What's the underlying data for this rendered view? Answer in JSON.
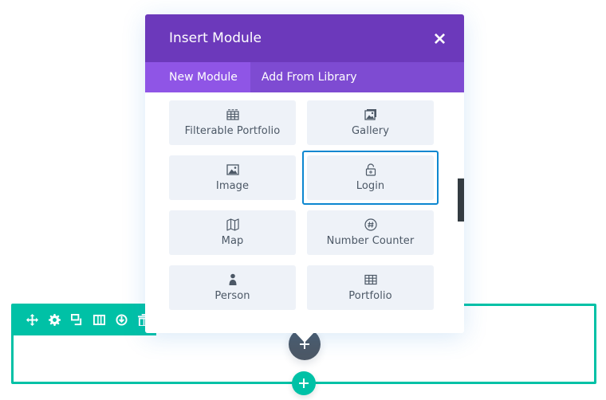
{
  "modal": {
    "title": "Insert Module",
    "close_icon": "close-icon",
    "tabs": [
      {
        "label": "New Module",
        "active": true
      },
      {
        "label": "Add From Library",
        "active": false
      }
    ],
    "modules": [
      {
        "label": "Filterable Portfolio",
        "icon": "grid-icon"
      },
      {
        "label": "Gallery",
        "icon": "gallery-icon"
      },
      {
        "label": "Image",
        "icon": "image-icon"
      },
      {
        "label": "Login",
        "icon": "unlock-icon",
        "selected": true
      },
      {
        "label": "Map",
        "icon": "map-icon"
      },
      {
        "label": "Number Counter",
        "icon": "hash-icon"
      },
      {
        "label": "Person",
        "icon": "person-icon"
      },
      {
        "label": "Portfolio",
        "icon": "grid-icon"
      }
    ]
  },
  "row_toolbar": {
    "buttons": [
      "move-icon",
      "gear-icon",
      "duplicate-icon",
      "columns-icon",
      "save-icon",
      "trash-icon"
    ]
  },
  "colors": {
    "header": "#6c39bb",
    "tabs_bar": "#7e4bd2",
    "tab_active": "#8f55e6",
    "row_accent": "#00c1a6",
    "selected_outline": "#0c87d0",
    "module_bg": "#eef2f8",
    "text": "#4c5866"
  }
}
